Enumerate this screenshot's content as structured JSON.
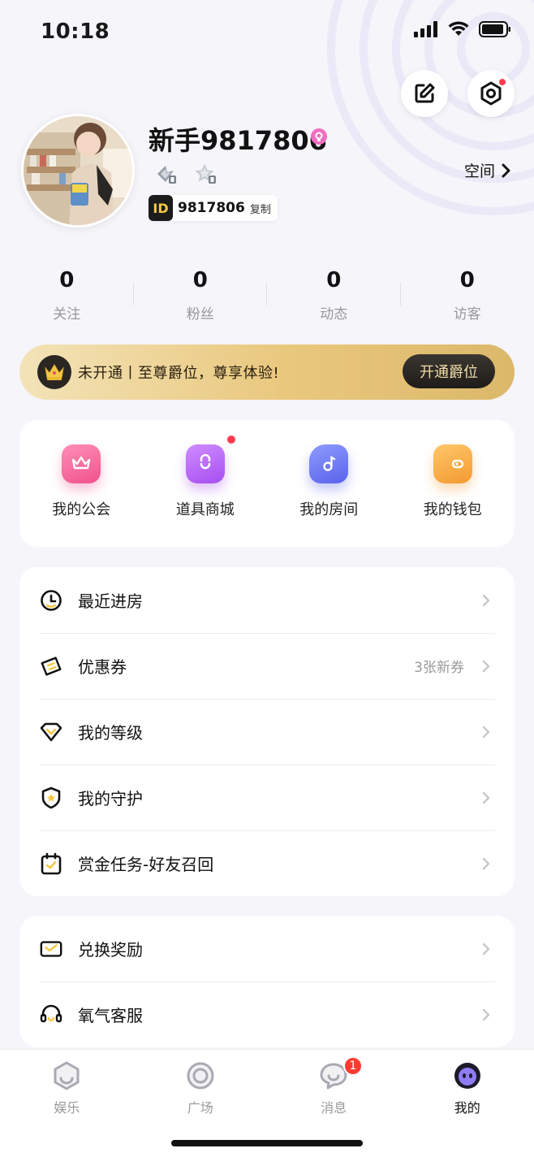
{
  "status_bar": {
    "time": "10:18"
  },
  "profile": {
    "username": "新手9817806",
    "id_tag": "ID",
    "id_number": "9817806",
    "copy_label": "复制",
    "space_link": "空间"
  },
  "stats": [
    {
      "value": "0",
      "label": "关注"
    },
    {
      "value": "0",
      "label": "粉丝"
    },
    {
      "value": "0",
      "label": "动态"
    },
    {
      "value": "0",
      "label": "访客"
    }
  ],
  "vip": {
    "text": "未开通丨至尊爵位，尊享体验!",
    "button": "开通爵位"
  },
  "quick_actions": [
    {
      "label": "我的公会",
      "icon": "crown-shield-icon",
      "color": "#f26b9b"
    },
    {
      "label": "道具商城",
      "icon": "shopping-bag-icon",
      "color": "#b45cf0",
      "has_dot": true
    },
    {
      "label": "我的房间",
      "icon": "music-house-icon",
      "color": "#6a76f2"
    },
    {
      "label": "我的钱包",
      "icon": "wallet-icon",
      "color": "#f3a23a"
    }
  ],
  "menu_group_1": [
    {
      "label": "最近进房",
      "icon": "clock-icon",
      "extra": ""
    },
    {
      "label": "优惠券",
      "icon": "coupon-icon",
      "extra": "3张新券"
    },
    {
      "label": "我的等级",
      "icon": "level-heart-icon",
      "extra": ""
    },
    {
      "label": "我的守护",
      "icon": "shield-star-icon",
      "extra": ""
    },
    {
      "label": "赏金任务-好友召回",
      "icon": "calendar-check-icon",
      "extra": ""
    }
  ],
  "menu_group_2": [
    {
      "label": "兑换奖励",
      "icon": "exchange-ticket-icon",
      "extra": ""
    },
    {
      "label": "氧气客服",
      "icon": "headset-icon",
      "extra": ""
    }
  ],
  "tabs": [
    {
      "label": "娱乐",
      "icon": "home-hex-icon",
      "active": false
    },
    {
      "label": "广场",
      "icon": "circle-ring-icon",
      "active": false
    },
    {
      "label": "消息",
      "icon": "chat-bubble-icon",
      "active": false,
      "badge": "1"
    },
    {
      "label": "我的",
      "icon": "mascot-face-icon",
      "active": true
    }
  ],
  "colors": {
    "accent_yellow": "#f5c944",
    "badge_red": "#ff3b30",
    "vip_gold": "#e9c77c",
    "background": "#f5f5fa"
  }
}
